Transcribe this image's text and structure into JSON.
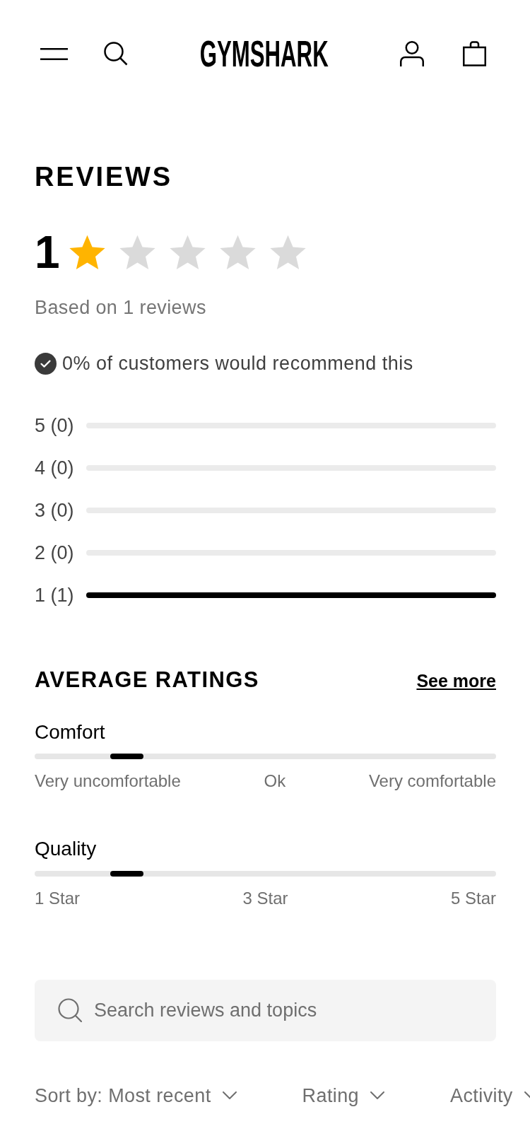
{
  "header": {
    "logo": "GYMSHARK"
  },
  "reviews": {
    "title": "REVIEWS",
    "score": "1",
    "stars": 1,
    "summary": "Based on 1 reviews",
    "recommendation": "0% of customers would recommend this"
  },
  "breakdown": [
    {
      "label": "5 (0)",
      "level": 0
    },
    {
      "label": "4 (0)",
      "level": 0
    },
    {
      "label": "3 (0)",
      "level": 0
    },
    {
      "label": "2 (0)",
      "level": 0
    },
    {
      "label": "1 (1)",
      "level": 1
    }
  ],
  "average_ratings": {
    "title": "AVERAGE RATINGS",
    "link": "See more",
    "items": [
      {
        "name": "Comfort",
        "level": 0.2,
        "scale": [
          "Very uncomfortable",
          "Ok",
          "Very comfortable"
        ]
      },
      {
        "name": "Quality",
        "level": 0.2,
        "scale": [
          "1 Star",
          "3 Star",
          "5 Star"
        ]
      }
    ]
  },
  "search": {
    "placeholder": "Search reviews and topics"
  },
  "filters": [
    {
      "label": "Sort by: Most recent"
    },
    {
      "label": "Rating"
    },
    {
      "label": "Activity"
    }
  ]
}
